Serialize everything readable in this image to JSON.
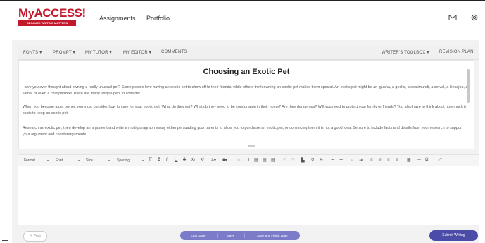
{
  "header": {
    "logo_text": "MyACCESS!",
    "logo_tagline": "BECAUSE WRITING MATTERS",
    "nav": [
      "Assignments",
      "Portfolio"
    ],
    "icons": [
      "mail-icon",
      "gear-icon"
    ]
  },
  "toolbar": {
    "left": [
      "FONTS ▾",
      "PROMPT ▾",
      "MY TUTOR ▾",
      "MY EDITOR ▾",
      "COMMENTS"
    ],
    "right": [
      "WRITER'S TOOLBOX ▾",
      "REVISION PLAN"
    ]
  },
  "prompt": {
    "title": "Choosing an Exotic Pet",
    "paragraphs": [
      "Have you ever thought about owning a really unusual pet? Some people love having an exotic pet to show off to their friends, while others think owning an exotic pet makes them special. An exotic pet might be an iguana, a gecko, a coatimundi, a serval, a kinkajou, a llama, or even a chimpanzee! There are many unique pets to consider.",
      "When you become a pet owner, you must consider how to care for your exotic pet. What do they eat? What do they need to be comfortable in their home? Are they dangerous? Will you need to protect your family or friends? You also have to think about how much it costs to keep an exotic pet.",
      "Research an exotic pet, then develop an argument and write a multi-paragraph essay either persuading your parents to allow you to purchase an exotic pet, or convincing them it is not a good idea. Be sure to include facts and details from your research to support your argument and counterarguments."
    ]
  },
  "editor_toolbar": {
    "format": "Format",
    "font": "Font",
    "size": "Size",
    "spacing": "Spacing"
  },
  "footer": {
    "post": "Post",
    "last_save": "Last Save:",
    "save": "Save",
    "save_finish": "Save and Finish Later",
    "submit": "Submit Writing"
  }
}
